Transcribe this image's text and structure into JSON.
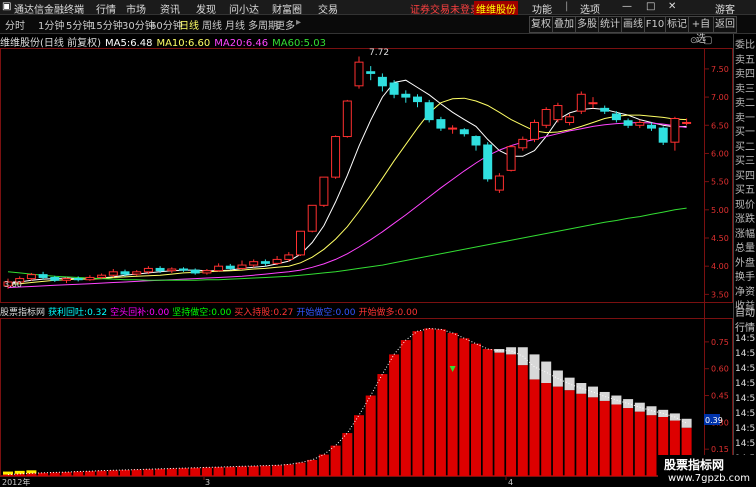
{
  "titlebar": {
    "app_name": "通达信金融终端",
    "menu": [
      "行情",
      "市场",
      "资讯",
      "发现",
      "问小达",
      "财富圈",
      "交易"
    ],
    "alert": "证券交易未登录",
    "stock_name": "维维股份",
    "right": [
      "功能",
      "选项"
    ],
    "user": "游客"
  },
  "toolbar": {
    "periods": [
      "分时",
      "1分钟",
      "5分钟",
      "15分钟",
      "30分钟",
      "60分钟",
      "日线",
      "周线",
      "月线",
      "多周期",
      "更多"
    ],
    "active_period": "日线",
    "right_buttons": [
      "复权",
      "叠加",
      "多股",
      "统计",
      "画线",
      "F10",
      "标记",
      "+自选",
      "返回"
    ]
  },
  "info": {
    "title": "维维股份(日线 前复权)",
    "ma5_label": "MA5:",
    "ma5": "6.48",
    "ma10_label": "MA10:",
    "ma10": "6.60",
    "ma20_label": "MA20:",
    "ma20": "6.46",
    "ma60_label": "MA60:",
    "ma60": "5.03"
  },
  "indicator": {
    "name": "股票指标网",
    "items": [
      {
        "label": "获利回吐:",
        "value": "0.32",
        "color": "#00ffff"
      },
      {
        "label": "空头回补:",
        "value": "0.00",
        "color": "#ff00ff"
      },
      {
        "label": "坚持做空:",
        "value": "0.00",
        "color": "#00ff00"
      },
      {
        "label": "买入持股:",
        "value": "0.27",
        "color": "#ff3333"
      },
      {
        "label": "开始做空:",
        "value": "0.00",
        "color": "#3355ff"
      },
      {
        "label": "开始做多:",
        "value": "0.00",
        "color": "#ff3333"
      }
    ]
  },
  "sidebar": {
    "top": [
      "委比",
      "卖五",
      "卖四",
      "卖三",
      "卖二",
      "卖一",
      "买一",
      "买二",
      "买三",
      "买四",
      "买五",
      "现价",
      "涨跌",
      "涨幅",
      "总量",
      "外盘",
      "换手",
      "净资",
      "收益"
    ],
    "bottom": [
      "自动",
      "行情",
      "14:5",
      "14:5",
      "14:5",
      "14:5",
      "14:5",
      "14:5",
      "14:5",
      "14:5",
      "14:5"
    ]
  },
  "price_axis": [
    "7.50",
    "7.00",
    "6.50",
    "6.00",
    "5.50",
    "5.00",
    "4.50",
    "4.00",
    "3.50"
  ],
  "ind_axis": [
    "0.75",
    "0.60",
    "0.45",
    "0.30",
    "0.15"
  ],
  "ind_current": "0.39",
  "date_labels": [
    "2012年",
    "3",
    "4"
  ],
  "price_annotations": {
    "high": "7.72",
    "low": "3.60"
  },
  "watermark": {
    "line1": "股票指标网",
    "line2": "www.7gpzb.com"
  },
  "chart_data": [
    {
      "type": "candlestick",
      "title": "维维股份(日线 前复权)",
      "ylim": [
        3.4,
        7.8
      ],
      "candles": [
        {
          "o": 3.65,
          "c": 3.72,
          "h": 3.78,
          "l": 3.6
        },
        {
          "o": 3.72,
          "c": 3.78,
          "h": 3.82,
          "l": 3.68
        },
        {
          "o": 3.78,
          "c": 3.85,
          "h": 3.88,
          "l": 3.74
        },
        {
          "o": 3.85,
          "c": 3.8,
          "h": 3.9,
          "l": 3.76
        },
        {
          "o": 3.8,
          "c": 3.75,
          "h": 3.83,
          "l": 3.72
        },
        {
          "o": 3.75,
          "c": 3.78,
          "h": 3.8,
          "l": 3.7
        },
        {
          "o": 3.78,
          "c": 3.76,
          "h": 3.82,
          "l": 3.73
        },
        {
          "o": 3.76,
          "c": 3.8,
          "h": 3.84,
          "l": 3.74
        },
        {
          "o": 3.8,
          "c": 3.84,
          "h": 3.87,
          "l": 3.77
        },
        {
          "o": 3.84,
          "c": 3.9,
          "h": 3.95,
          "l": 3.8
        },
        {
          "o": 3.9,
          "c": 3.86,
          "h": 3.94,
          "l": 3.82
        },
        {
          "o": 3.86,
          "c": 3.9,
          "h": 3.93,
          "l": 3.83
        },
        {
          "o": 3.9,
          "c": 3.96,
          "h": 4.0,
          "l": 3.86
        },
        {
          "o": 3.96,
          "c": 3.92,
          "h": 4.0,
          "l": 3.88
        },
        {
          "o": 3.92,
          "c": 3.95,
          "h": 3.98,
          "l": 3.88
        },
        {
          "o": 3.95,
          "c": 3.93,
          "h": 3.98,
          "l": 3.9
        },
        {
          "o": 3.93,
          "c": 3.88,
          "h": 3.96,
          "l": 3.85
        },
        {
          "o": 3.88,
          "c": 3.92,
          "h": 3.95,
          "l": 3.85
        },
        {
          "o": 3.92,
          "c": 4.0,
          "h": 4.05,
          "l": 3.9
        },
        {
          "o": 4.0,
          "c": 3.96,
          "h": 4.04,
          "l": 3.93
        },
        {
          "o": 3.96,
          "c": 4.02,
          "h": 4.1,
          "l": 3.94
        },
        {
          "o": 4.02,
          "c": 4.08,
          "h": 4.12,
          "l": 3.98
        },
        {
          "o": 4.08,
          "c": 4.05,
          "h": 4.12,
          "l": 4.0
        },
        {
          "o": 4.05,
          "c": 4.12,
          "h": 4.18,
          "l": 4.02
        },
        {
          "o": 4.12,
          "c": 4.2,
          "h": 4.25,
          "l": 4.08
        },
        {
          "o": 4.2,
          "c": 4.62,
          "h": 4.62,
          "l": 4.18
        },
        {
          "o": 4.62,
          "c": 5.08,
          "h": 5.08,
          "l": 4.6
        },
        {
          "o": 5.08,
          "c": 5.58,
          "h": 5.58,
          "l": 5.05
        },
        {
          "o": 5.58,
          "c": 6.3,
          "h": 6.32,
          "l": 5.55
        },
        {
          "o": 6.3,
          "c": 6.93,
          "h": 6.95,
          "l": 6.28
        },
        {
          "o": 7.2,
          "c": 7.62,
          "h": 7.72,
          "l": 7.15
        },
        {
          "o": 7.45,
          "c": 7.42,
          "h": 7.55,
          "l": 7.3
        },
        {
          "o": 7.35,
          "c": 7.2,
          "h": 7.42,
          "l": 7.1
        },
        {
          "o": 7.25,
          "c": 7.05,
          "h": 7.3,
          "l": 6.98
        },
        {
          "o": 7.05,
          "c": 7.0,
          "h": 7.12,
          "l": 6.9
        },
        {
          "o": 7.0,
          "c": 6.92,
          "h": 7.05,
          "l": 6.82
        },
        {
          "o": 6.9,
          "c": 6.6,
          "h": 6.95,
          "l": 6.55
        },
        {
          "o": 6.6,
          "c": 6.45,
          "h": 6.65,
          "l": 6.4
        },
        {
          "o": 6.45,
          "c": 6.45,
          "h": 6.5,
          "l": 6.35
        },
        {
          "o": 6.42,
          "c": 6.35,
          "h": 6.45,
          "l": 6.3
        },
        {
          "o": 6.3,
          "c": 6.15,
          "h": 6.32,
          "l": 6.05
        },
        {
          "o": 6.15,
          "c": 5.55,
          "h": 6.2,
          "l": 5.5
        },
        {
          "o": 5.35,
          "c": 5.6,
          "h": 5.65,
          "l": 5.3
        },
        {
          "o": 5.7,
          "c": 6.12,
          "h": 6.15,
          "l": 5.68
        },
        {
          "o": 6.1,
          "c": 6.25,
          "h": 6.3,
          "l": 6.05
        },
        {
          "o": 6.25,
          "c": 6.55,
          "h": 6.6,
          "l": 6.2
        },
        {
          "o": 6.5,
          "c": 6.78,
          "h": 6.82,
          "l": 6.45
        },
        {
          "o": 6.6,
          "c": 6.85,
          "h": 6.9,
          "l": 6.55
        },
        {
          "o": 6.55,
          "c": 6.65,
          "h": 6.7,
          "l": 6.5
        },
        {
          "o": 6.75,
          "c": 7.05,
          "h": 7.1,
          "l": 6.7
        },
        {
          "o": 6.9,
          "c": 6.9,
          "h": 7.0,
          "l": 6.8
        },
        {
          "o": 6.8,
          "c": 6.75,
          "h": 6.85,
          "l": 6.7
        },
        {
          "o": 6.7,
          "c": 6.6,
          "h": 6.75,
          "l": 6.55
        },
        {
          "o": 6.58,
          "c": 6.5,
          "h": 6.62,
          "l": 6.45
        },
        {
          "o": 6.5,
          "c": 6.55,
          "h": 6.6,
          "l": 6.45
        },
        {
          "o": 6.5,
          "c": 6.45,
          "h": 6.55,
          "l": 6.4
        },
        {
          "o": 6.45,
          "c": 6.2,
          "h": 6.48,
          "l": 6.15
        },
        {
          "o": 6.2,
          "c": 6.62,
          "h": 6.65,
          "l": 6.05
        },
        {
          "o": 6.55,
          "c": 6.55,
          "h": 6.62,
          "l": 6.5
        }
      ],
      "ma_series": [
        {
          "name": "MA5",
          "color": "#ffffff",
          "values": [
            3.7,
            3.72,
            3.75,
            3.77,
            3.78,
            3.79,
            3.78,
            3.77,
            3.79,
            3.81,
            3.84,
            3.86,
            3.88,
            3.9,
            3.92,
            3.93,
            3.93,
            3.92,
            3.92,
            3.93,
            3.96,
            3.98,
            4.0,
            4.04,
            4.09,
            4.21,
            4.42,
            4.72,
            5.14,
            5.61,
            6.13,
            6.59,
            7.0,
            7.26,
            7.3,
            7.17,
            7.04,
            6.88,
            6.73,
            6.6,
            6.48,
            6.25,
            6.05,
            5.95,
            5.95,
            6.05,
            6.3,
            6.6,
            6.72,
            6.78,
            6.8,
            6.78,
            6.73,
            6.68,
            6.6,
            6.55,
            6.5,
            6.47,
            6.48
          ]
        },
        {
          "name": "MA10",
          "color": "#ffff66",
          "values": [
            3.68,
            3.69,
            3.71,
            3.73,
            3.75,
            3.76,
            3.77,
            3.77,
            3.78,
            3.8,
            3.81,
            3.82,
            3.83,
            3.84,
            3.86,
            3.88,
            3.89,
            3.9,
            3.91,
            3.92,
            3.93,
            3.95,
            3.96,
            3.98,
            4.0,
            4.06,
            4.16,
            4.3,
            4.48,
            4.7,
            4.97,
            5.26,
            5.56,
            5.87,
            6.16,
            6.45,
            6.72,
            6.9,
            6.97,
            6.98,
            6.93,
            6.85,
            6.73,
            6.6,
            6.5,
            6.4,
            6.37,
            6.38,
            6.42,
            6.48,
            6.55,
            6.62,
            6.66,
            6.68,
            6.68,
            6.66,
            6.64,
            6.61,
            6.6
          ]
        },
        {
          "name": "MA20",
          "color": "#ff44ff",
          "values": [
            3.62,
            3.63,
            3.64,
            3.65,
            3.66,
            3.67,
            3.68,
            3.69,
            3.7,
            3.71,
            3.72,
            3.73,
            3.74,
            3.75,
            3.76,
            3.77,
            3.78,
            3.79,
            3.8,
            3.81,
            3.82,
            3.84,
            3.86,
            3.88,
            3.9,
            3.93,
            3.98,
            4.04,
            4.12,
            4.22,
            4.34,
            4.47,
            4.61,
            4.76,
            4.91,
            5.07,
            5.23,
            5.39,
            5.54,
            5.69,
            5.83,
            5.96,
            6.06,
            6.14,
            6.2,
            6.25,
            6.3,
            6.35,
            6.4,
            6.44,
            6.48,
            6.51,
            6.53,
            6.54,
            6.55,
            6.54,
            6.52,
            6.49,
            6.46
          ]
        },
        {
          "name": "MA60",
          "color": "#33dd33",
          "values": [
            3.9,
            3.88,
            3.86,
            3.84,
            3.82,
            3.81,
            3.8,
            3.79,
            3.78,
            3.77,
            3.76,
            3.76,
            3.75,
            3.75,
            3.75,
            3.75,
            3.75,
            3.76,
            3.76,
            3.77,
            3.78,
            3.79,
            3.8,
            3.81,
            3.82,
            3.84,
            3.86,
            3.88,
            3.9,
            3.93,
            3.96,
            3.99,
            4.02,
            4.06,
            4.1,
            4.14,
            4.18,
            4.22,
            4.26,
            4.3,
            4.34,
            4.38,
            4.42,
            4.46,
            4.5,
            4.54,
            4.58,
            4.62,
            4.66,
            4.7,
            4.74,
            4.78,
            4.81,
            4.85,
            4.88,
            4.92,
            4.96,
            5.0,
            5.03
          ]
        }
      ]
    },
    {
      "type": "bar",
      "title": "股票指标网",
      "ylim": [
        0,
        0.85
      ],
      "series": [
        {
          "name": "买入持股",
          "color": "#ff0000",
          "values": [
            0.008,
            0.012,
            0.015,
            0.018,
            0.02,
            0.022,
            0.025,
            0.027,
            0.03,
            0.032,
            0.034,
            0.036,
            0.038,
            0.04,
            0.042,
            0.044,
            0.046,
            0.048,
            0.05,
            0.052,
            0.054,
            0.056,
            0.058,
            0.06,
            0.065,
            0.075,
            0.09,
            0.12,
            0.17,
            0.24,
            0.34,
            0.45,
            0.57,
            0.68,
            0.76,
            0.81,
            0.825,
            0.82,
            0.8,
            0.77,
            0.74,
            0.71,
            0.69,
            0.68,
            0.62,
            0.54,
            0.52,
            0.5,
            0.48,
            0.46,
            0.44,
            0.42,
            0.4,
            0.38,
            0.36,
            0.34,
            0.33,
            0.31,
            0.27
          ]
        },
        {
          "name": "获利回吐",
          "color": "#d8d8d8",
          "values": [
            0,
            0,
            0,
            0,
            0,
            0,
            0,
            0,
            0,
            0,
            0,
            0,
            0,
            0,
            0,
            0,
            0,
            0,
            0,
            0,
            0,
            0,
            0,
            0,
            0,
            0,
            0,
            0,
            0,
            0,
            0,
            0,
            0,
            0,
            0,
            0,
            0,
            0,
            0,
            0,
            0,
            0,
            0.02,
            0.04,
            0.1,
            0.14,
            0.12,
            0.09,
            0.07,
            0.06,
            0.06,
            0.05,
            0.05,
            0.05,
            0.05,
            0.05,
            0.04,
            0.04,
            0.05
          ]
        }
      ]
    }
  ]
}
